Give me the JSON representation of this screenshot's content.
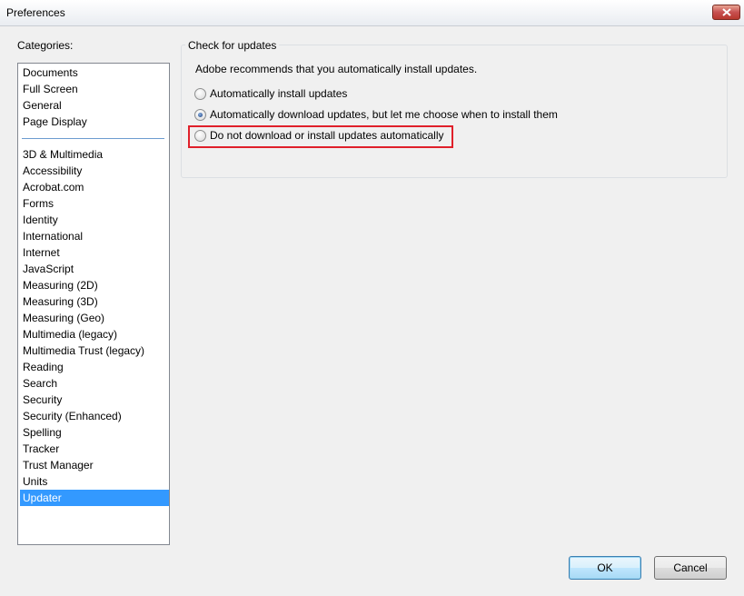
{
  "window": {
    "title": "Preferences"
  },
  "categories_label": "Categories:",
  "categories": [
    "Documents",
    "Full Screen",
    "General",
    "Page Display",
    "3D & Multimedia",
    "Accessibility",
    "Acrobat.com",
    "Forms",
    "Identity",
    "International",
    "Internet",
    "JavaScript",
    "Measuring (2D)",
    "Measuring (3D)",
    "Measuring (Geo)",
    "Multimedia (legacy)",
    "Multimedia Trust (legacy)",
    "Reading",
    "Search",
    "Security",
    "Security (Enhanced)",
    "Spelling",
    "Tracker",
    "Trust Manager",
    "Units",
    "Updater"
  ],
  "selected_category": "Updater",
  "updates": {
    "group_title": "Check for updates",
    "description": "Adobe recommends that you automatically install updates.",
    "options": [
      {
        "label": "Automatically install updates",
        "checked": false
      },
      {
        "label": "Automatically download updates, but let me choose when to install them",
        "checked": true
      },
      {
        "label": "Do not download or install updates automatically",
        "checked": false,
        "highlighted": true
      }
    ]
  },
  "buttons": {
    "ok": "OK",
    "cancel": "Cancel"
  },
  "colors": {
    "selection": "#3399ff",
    "highlight_box": "#e0202a"
  },
  "icons": {
    "close": "close-icon"
  }
}
